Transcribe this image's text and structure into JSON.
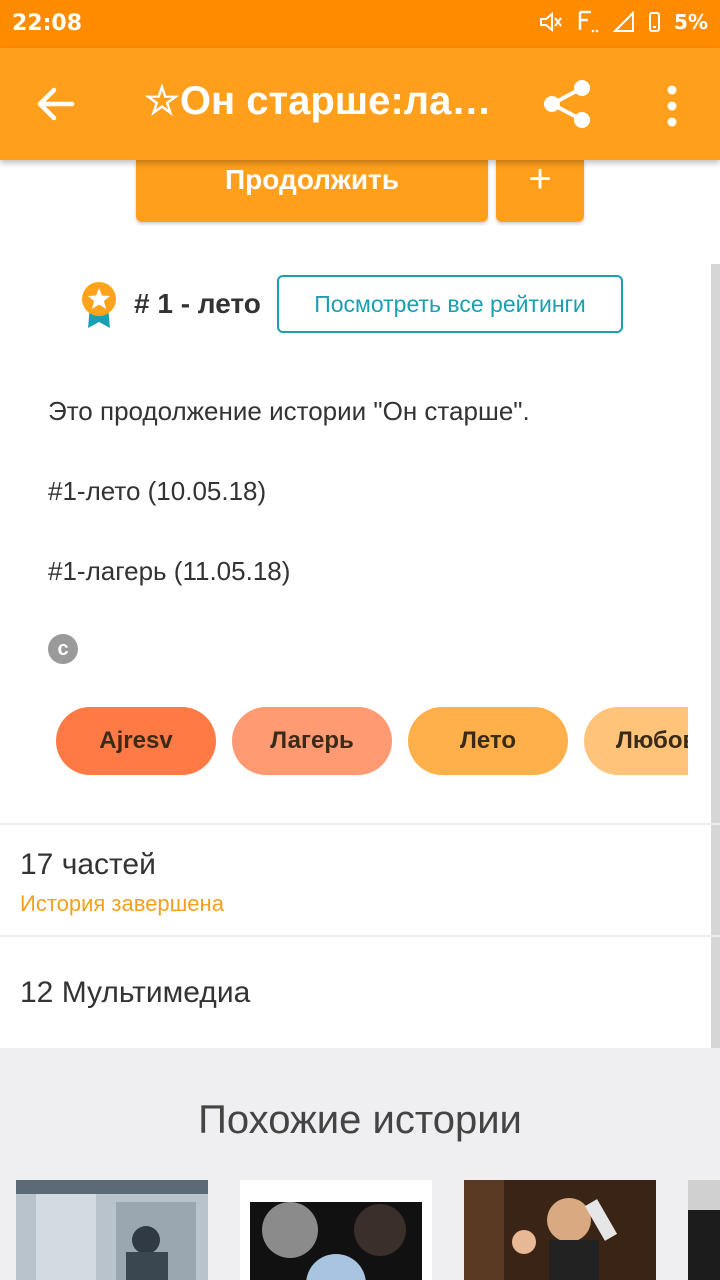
{
  "status_bar": {
    "time": "22:08",
    "battery": "5%",
    "icons": [
      "mute-icon",
      "network-type-icon",
      "signal-icon",
      "battery-icon"
    ]
  },
  "app_bar": {
    "title": "☆Он старше:лаг…",
    "icons": [
      "back-arrow-icon",
      "share-icon",
      "more-vert-icon"
    ],
    "color": "#ff9f1c"
  },
  "actions": {
    "continue_label": "Продолжить",
    "add_label": "+"
  },
  "rank": {
    "text": "# 1 - лето",
    "ratings_button": "Посмотреть все рейтинги"
  },
  "description": {
    "lines": [
      "Это продолжение истории \"Он старше\".",
      "#1-лето (10.05.18)",
      "#1-лагерь (11.05.18)"
    ],
    "copyright_symbol": "c"
  },
  "tags": [
    {
      "label": "Ajresv",
      "color": "#ff7a45"
    },
    {
      "label": "Лагерь",
      "color": "#ff9a72"
    },
    {
      "label": "Лето",
      "color": "#ffb04a"
    },
    {
      "label": "Любовь",
      "color": "#ffc47a"
    }
  ],
  "parts": {
    "title": "17 частей",
    "status": "История завершена"
  },
  "media": {
    "title": "12 Мультимедиа"
  },
  "similar": {
    "title": "Похожие истории"
  },
  "colors": {
    "status_bar": "#ff8c00",
    "accent": "#ff9f1c",
    "link": "#1a9fb0",
    "completed": "#f5a01f"
  }
}
